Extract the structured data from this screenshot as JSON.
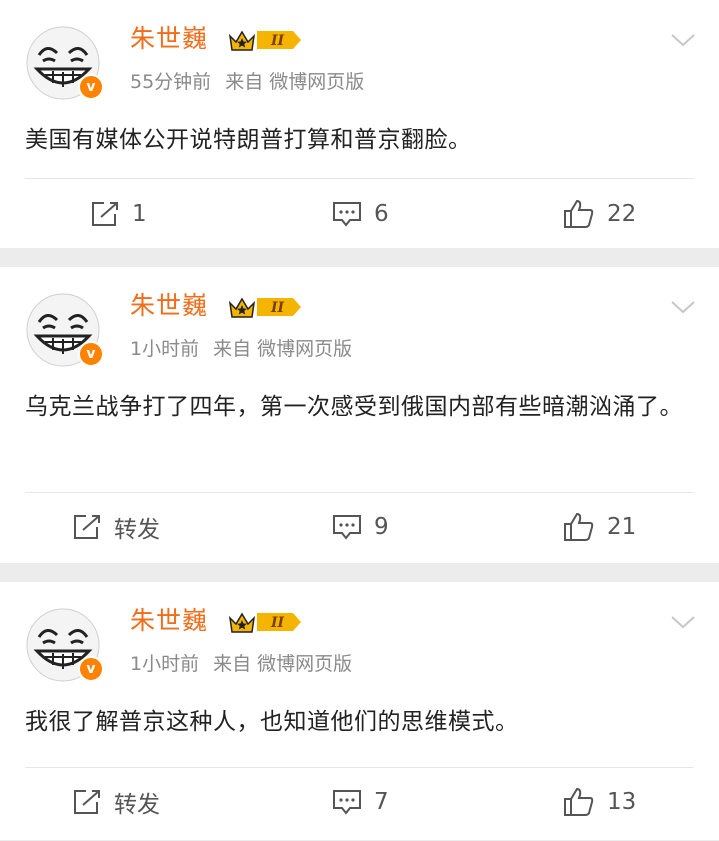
{
  "colors": {
    "accent": "#f26d1a",
    "badge": "#ff8200",
    "meta": "#8a8a8a",
    "background": "#ececec"
  },
  "posts": [
    {
      "author": "朱世巍",
      "time": "55分钟前",
      "source": "来自 微博网页版",
      "text": "美国有媒体公开说特朗普打算和普京翻脸。",
      "repost_label": "1",
      "comments": "6",
      "likes": "22"
    },
    {
      "author": "朱世巍",
      "time": "1小时前",
      "source": "来自 微博网页版",
      "text": "乌克兰战争打了四年，第一次感受到俄国内部有些暗潮汹涌了。",
      "repost_label": "转发",
      "comments": "9",
      "likes": "21"
    },
    {
      "author": "朱世巍",
      "time": "1小时前",
      "source": "来自 微博网页版",
      "text": "我很了解普京这种人，也知道他们的思维模式。",
      "repost_label": "转发",
      "comments": "7",
      "likes": "13"
    }
  ],
  "badge": {
    "verified_letter": "v",
    "level_label": "II"
  },
  "icons": {
    "avatar": "smiley-avatar",
    "crown": "crown-level-icon",
    "menu": "chevron-down-icon",
    "repost": "repost-icon",
    "comment": "comment-icon",
    "like": "thumbs-up-icon"
  }
}
